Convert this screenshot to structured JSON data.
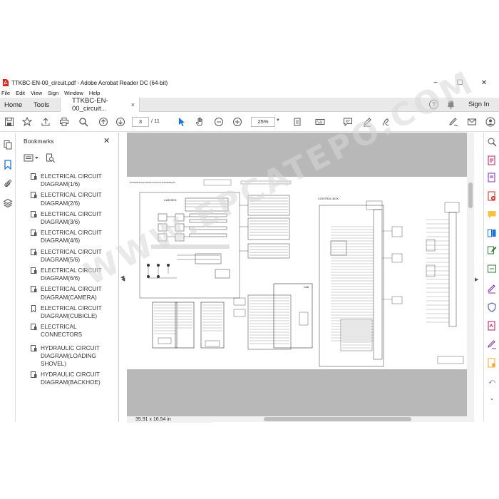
{
  "window": {
    "title": "TTKBC-EN-00_circuit.pdf - Adobe Acrobat Reader DC (64-bit)",
    "controls": {
      "minimize": "−",
      "maximize": "☐",
      "close": "✕"
    }
  },
  "menu": [
    "File",
    "Edit",
    "View",
    "Sign",
    "Window",
    "Help"
  ],
  "tabs": {
    "home": "Home",
    "tools": "Tools",
    "document": "TTKBC-EN-00_circuit...",
    "document_close": "×",
    "help": "?",
    "sign_in": "Sign In"
  },
  "toolbar": {
    "page_current": "3",
    "page_total": "/ 11",
    "zoom": "25%"
  },
  "bookmarks": {
    "title": "Bookmarks",
    "close": "✕",
    "collapse": "◀",
    "items": [
      {
        "label": "ELECTRICAL CIRCUIT DIAGRAM(1/6)",
        "icon": "page-bookmark-icon"
      },
      {
        "label": "ELECTRICAL CIRCUIT DIAGRAM(2/6)",
        "icon": "page-bookmark-icon"
      },
      {
        "label": "ELECTRICAL CIRCUIT DIAGRAM(3/6)",
        "icon": "page-bookmark-icon"
      },
      {
        "label": "ELECTRICAL CIRCUIT DIAGRAM(4/6)",
        "icon": "page-bookmark-icon"
      },
      {
        "label": "ELECTRICAL CIRCUIT DIAGRAM(5/6)",
        "icon": "page-bookmark-icon"
      },
      {
        "label": "ELECTRICAL CIRCUIT DIAGRAM(6/6)",
        "icon": "page-bookmark-icon"
      },
      {
        "label": "ELECTRICAL CIRCUIT DIAGRAM(CAMERA)",
        "icon": "page-bookmark-icon"
      },
      {
        "label": "ELECTRICAL CIRCUIT DIAGRAM(CUBICLE)",
        "icon": "ribbon-bookmark-icon"
      },
      {
        "label": "ELECTRICAL CONNECTORS",
        "icon": "page-bookmark-icon"
      },
      {
        "label": "HYDRAULIC CIRCUIT DIAGRAM(LOADING SHOVEL)",
        "icon": "page-bookmark-icon"
      },
      {
        "label": "HYDRAULIC CIRCUIT DIAGRAM(BACKHOE)",
        "icon": "page-bookmark-icon"
      }
    ]
  },
  "page": {
    "header_title": "EX1900B-6 ELECTRICAL CIRCUIT DIAGRAM(3/6)",
    "labels": {
      "cab_bed": "CAB BED",
      "control_box": "CONTROL BOX",
      "cab": "CAB"
    }
  },
  "status": {
    "page_size": "35.91 x 16.54 in"
  },
  "watermark": "WWW.EPCATEPO.COM",
  "colors": {
    "accent": "#1473e6",
    "pdf_red": "#d9261c",
    "doc_bg": "#b8b8b8"
  }
}
